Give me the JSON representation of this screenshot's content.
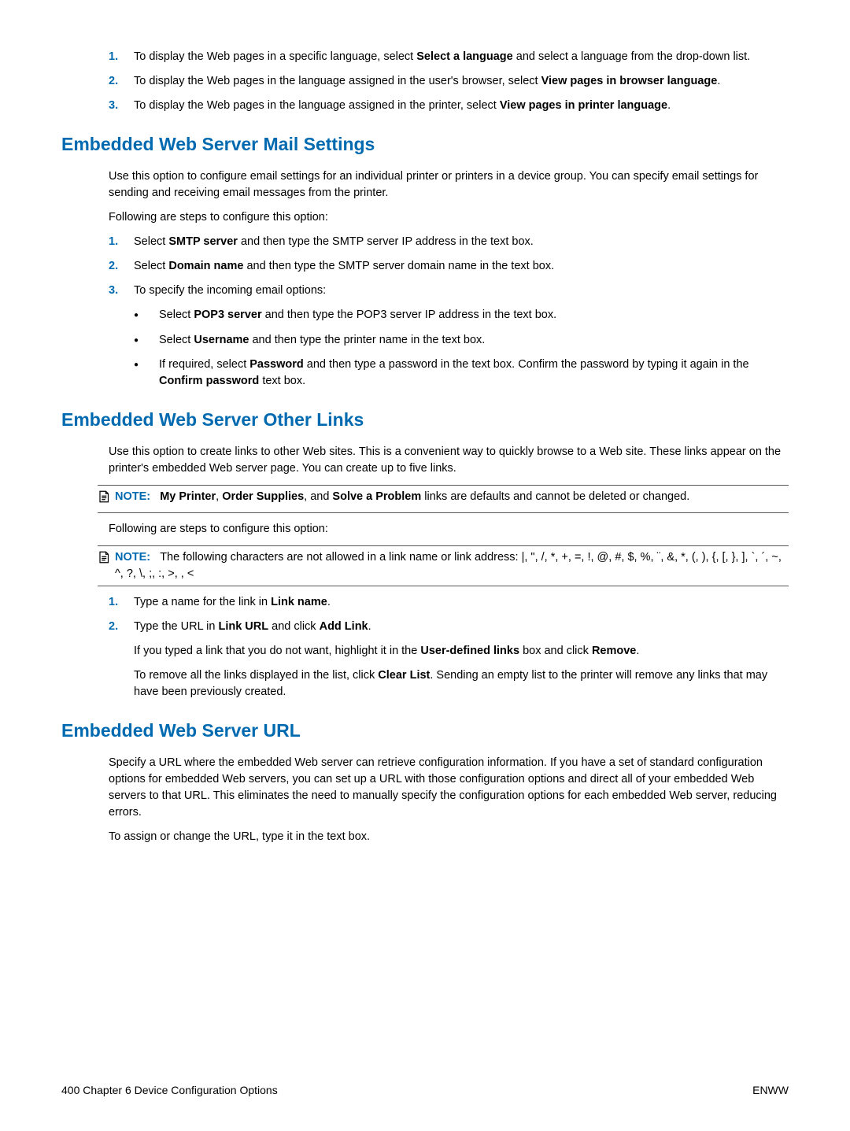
{
  "step_a": {
    "n1": "1.",
    "t1a": "To display the Web pages in a specific language, select ",
    "t1b": "Select a language",
    "t1c": " and select a language from the drop-down list.",
    "n2": "2.",
    "t2a": "To display the Web pages in the language assigned in the user's browser, select ",
    "t2b": "View pages in browser language",
    "t2c": ".",
    "n3": "3.",
    "t3a": "To display the Web pages in the language assigned in the printer, select ",
    "t3b": "View pages in printer language",
    "t3c": "."
  },
  "mail": {
    "heading": "Embedded Web Server Mail Settings",
    "p1": "Use this option to configure email settings for an individual printer or printers in a device group. You can specify email settings for sending and receiving email messages from the printer.",
    "p2": "Following are steps to configure this option:",
    "n1": "1.",
    "t1a": "Select ",
    "t1b": "SMTP server",
    "t1c": " and then type the SMTP server IP address in the text box.",
    "n2": "2.",
    "t2a": "Select ",
    "t2b": "Domain name",
    "t2c": " and then type the SMTP server domain name in the text box.",
    "n3": "3.",
    "t3": "To specify the incoming email options:",
    "b1a": "Select ",
    "b1b": "POP3 server",
    "b1c": " and then type the POP3 server IP address in the text box.",
    "b2a": "Select ",
    "b2b": "Username",
    "b2c": " and then type the printer name in the text box.",
    "b3a": "If required, select ",
    "b3b": "Password",
    "b3c": " and then type a password in the text box. Confirm the password by typing it again in the ",
    "b3d": "Confirm password",
    "b3e": " text box."
  },
  "other": {
    "heading": "Embedded Web Server Other Links",
    "p1": "Use this option to create links to other Web sites. This is a convenient way to quickly browse to a Web site. These links appear on the printer's embedded Web server page. You can create up to five links.",
    "note1_label": "NOTE:",
    "note1_a": "My Printer",
    "note1_b": ", ",
    "note1_c": "Order Supplies",
    "note1_d": ", and ",
    "note1_e": "Solve a Problem",
    "note1_f": " links are defaults and cannot be deleted or changed.",
    "p2": "Following are steps to configure this option:",
    "note2_label": "NOTE:",
    "note2_text": "The following characters are not allowed in a link name or link address: |, \", /, *, +, =, !, @, #, $, %, ¨, &, *, (, ), {, [, }, ], `, ´, ~, ^, ?, \\, ;, :, >, , <",
    "n1": "1.",
    "t1a": "Type a name for the link in ",
    "t1b": "Link name",
    "t1c": ".",
    "n2": "2.",
    "t2a": "Type the URL in ",
    "t2b": "Link URL",
    "t2c": " and click ",
    "t2d": "Add Link",
    "t2e": ".",
    "sub1a": "If you typed a link that you do not want, highlight it in the ",
    "sub1b": "User-defined links",
    "sub1c": " box and click ",
    "sub1d": "Remove",
    "sub1e": ".",
    "sub2a": "To remove all the links displayed in the list, click ",
    "sub2b": "Clear List",
    "sub2c": ". Sending an empty list to the printer will remove any links that may have been previously created."
  },
  "url": {
    "heading": "Embedded Web Server URL",
    "p1": "Specify a URL where the embedded Web server can retrieve configuration information. If you have a set of standard configuration options for embedded Web servers, you can set up a URL with those configuration options and direct all of your embedded Web servers to that URL. This eliminates the need to manually specify the configuration options for each embedded Web server, reducing errors.",
    "p2": "To assign or change the URL, type it in the text box."
  },
  "footer": {
    "left": "400   Chapter 6   Device Configuration Options",
    "right": "ENWW"
  }
}
